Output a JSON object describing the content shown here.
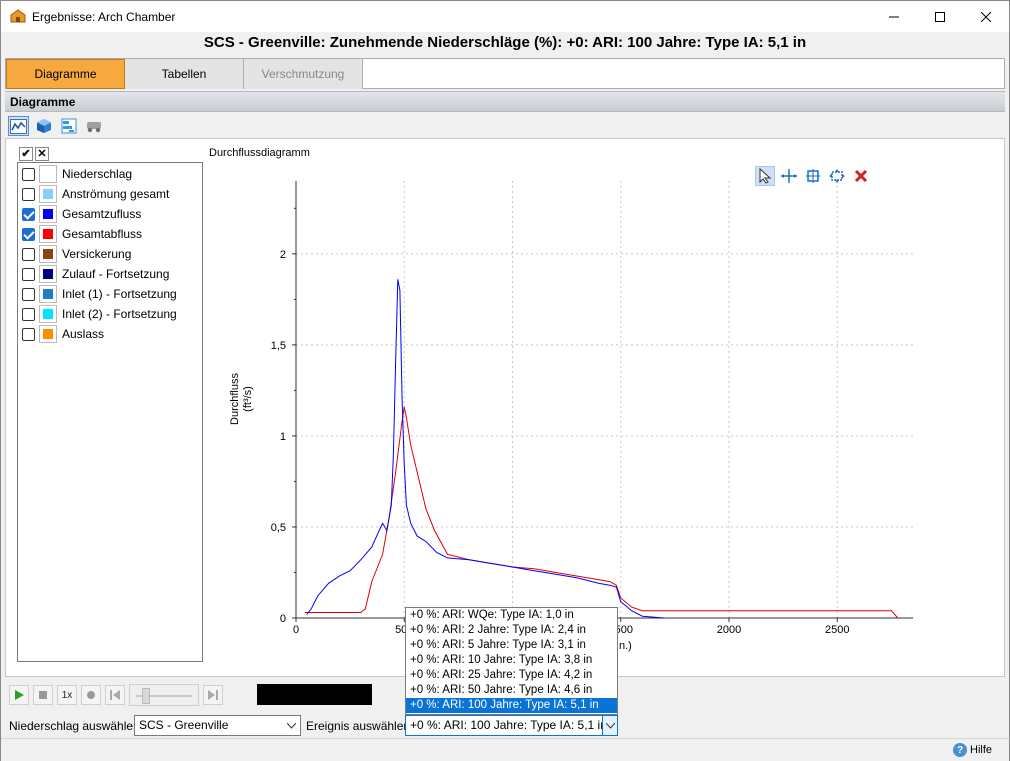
{
  "window": {
    "title": "Ergebnisse: Arch Chamber",
    "heading": "SCS - Greenville: Zunehmende Niederschläge (%): +0: ARI: 100 Jahre: Type IA: 5,1 in"
  },
  "tabs": [
    {
      "label": "Diagramme",
      "active": true
    },
    {
      "label": "Tabellen",
      "active": false
    },
    {
      "label": "Verschmutzung",
      "active": false,
      "disabled": true
    }
  ],
  "section_title": "Diagramme",
  "series": [
    {
      "label": "Niederschlag",
      "checked": false,
      "color": "#ffffff"
    },
    {
      "label": "Anströmung gesamt",
      "checked": false,
      "color": "#87cefa"
    },
    {
      "label": "Gesamtzufluss",
      "checked": true,
      "color": "#0000ff"
    },
    {
      "label": "Gesamtabfluss",
      "checked": true,
      "color": "#ff0000"
    },
    {
      "label": "Versickerung",
      "checked": false,
      "color": "#8b4513"
    },
    {
      "label": "Zulauf - Fortsetzung",
      "checked": false,
      "color": "#000080"
    },
    {
      "label": "Inlet (1) - Fortsetzung",
      "checked": false,
      "color": "#1f7fc4"
    },
    {
      "label": "Inlet (2) - Fortsetzung",
      "checked": false,
      "color": "#00e5ff"
    },
    {
      "label": "Auslass",
      "checked": false,
      "color": "#ff8c00"
    }
  ],
  "chart_title": "Durchflussdiagramm",
  "chart_data": {
    "type": "line",
    "title": "Durchflussdiagramm",
    "ylabel": "Durchfluss",
    "yunit": "(ft³/s)",
    "xlabel_visible_fragment": "n.)",
    "xlim": [
      0,
      2850
    ],
    "ylim": [
      0,
      2.4
    ],
    "xticks": [
      "0",
      "500",
      "1000",
      "1500",
      "2000",
      "2500"
    ],
    "xtick_values": [
      0,
      500,
      1000,
      1500,
      2000,
      2500
    ],
    "yticks": [
      "0",
      "0,5",
      "1",
      "1,5",
      "2"
    ],
    "ytick_values": [
      0,
      0.5,
      1,
      1.5,
      2
    ],
    "grid": true,
    "series": [
      {
        "name": "Gesamtzufluss",
        "color": "#0000ff",
        "x": [
          50,
          70,
          100,
          150,
          200,
          250,
          300,
          350,
          380,
          400,
          420,
          440,
          450,
          460,
          470,
          480,
          490,
          500,
          510,
          530,
          560,
          600,
          650,
          700,
          800,
          900,
          1000,
          1100,
          1200,
          1300,
          1400,
          1450,
          1480,
          1500,
          1550,
          1600,
          1700
        ],
        "y": [
          0.02,
          0.05,
          0.12,
          0.19,
          0.23,
          0.26,
          0.32,
          0.39,
          0.47,
          0.52,
          0.48,
          0.62,
          0.9,
          1.4,
          1.86,
          1.8,
          1.2,
          0.85,
          0.62,
          0.52,
          0.45,
          0.42,
          0.36,
          0.33,
          0.32,
          0.3,
          0.28,
          0.26,
          0.24,
          0.22,
          0.19,
          0.18,
          0.17,
          0.09,
          0.04,
          0.01,
          0.0
        ]
      },
      {
        "name": "Gesamtabfluss",
        "color": "#e00000",
        "x": [
          40,
          100,
          200,
          300,
          320,
          350,
          400,
          430,
          460,
          490,
          500,
          510,
          530,
          560,
          600,
          640,
          700,
          800,
          900,
          1000,
          1100,
          1200,
          1300,
          1400,
          1450,
          1480,
          1500,
          1550,
          1600,
          1700,
          2000,
          2500,
          2750,
          2780
        ],
        "y": [
          0.03,
          0.03,
          0.03,
          0.03,
          0.05,
          0.2,
          0.35,
          0.55,
          0.8,
          1.08,
          1.16,
          1.1,
          0.95,
          0.8,
          0.6,
          0.48,
          0.35,
          0.32,
          0.3,
          0.28,
          0.27,
          0.25,
          0.23,
          0.21,
          0.2,
          0.18,
          0.11,
          0.06,
          0.04,
          0.04,
          0.04,
          0.04,
          0.04,
          0.0
        ]
      }
    ]
  },
  "event_options": [
    "+0 %: ARI: WQe: Type IA: 1,0 in",
    "+0 %: ARI: 2 Jahre: Type IA: 2,4 in",
    "+0 %: ARI: 5 Jahre: Type IA: 3,1 in",
    "+0 %: ARI: 10 Jahre: Type IA: 3,8 in",
    "+0 %: ARI: 25 Jahre: Type IA: 4,2 in",
    "+0 %: ARI: 50 Jahre: Type IA: 4,6 in",
    "+0 %: ARI: 100 Jahre: Type IA: 5,1 in"
  ],
  "selected_event_index": 6,
  "player": {
    "speed_label": "1x"
  },
  "bottom": {
    "rain_label": "Niederschlag auswählen:",
    "rain_value": "SCS - Greenville",
    "event_label": "Ereignis auswählen:",
    "event_value": "+0 %: ARI: 100 Jahre: Type IA: 5,1 in"
  },
  "help_label": "Hilfe"
}
